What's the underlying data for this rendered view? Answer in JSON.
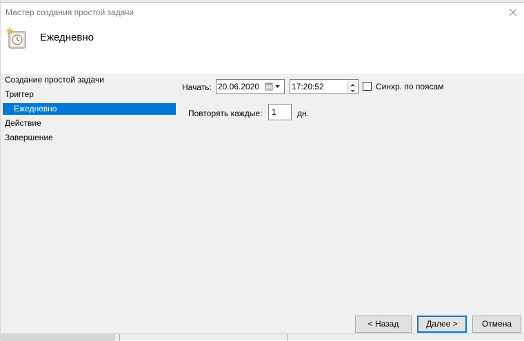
{
  "window": {
    "title": "Мастер создания простой задачи"
  },
  "header": {
    "title": "Ежедневно"
  },
  "nav": {
    "items": [
      {
        "label": "Создание простой задачи"
      },
      {
        "label": "Триггер"
      },
      {
        "label": "Ежедневно"
      },
      {
        "label": "Действие"
      },
      {
        "label": "Завершение"
      }
    ],
    "selected_index": 2
  },
  "form": {
    "start_label": "Начать:",
    "start_date": "20.06.2020",
    "start_time": "17:20:52",
    "sync_label": "Синхр. по поясам",
    "sync_checked": false,
    "repeat_label": "Повторять каждые:",
    "repeat_value": "1",
    "repeat_unit": "дн."
  },
  "buttons": {
    "back": "< Назад",
    "next": "Далее >",
    "cancel": "Отмена"
  },
  "colors": {
    "selection": "#0078d7",
    "panel": "#f0f0f0"
  }
}
